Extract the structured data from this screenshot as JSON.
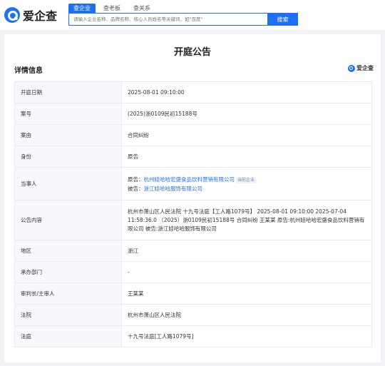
{
  "header": {
    "logo_text": "爱企查",
    "tabs": [
      {
        "label": "查企业",
        "active": true
      },
      {
        "label": "查老板",
        "active": false
      },
      {
        "label": "查关系",
        "active": false
      }
    ],
    "search_placeholder": "请输入企业名称、品牌名称、核心人员姓名等关键词，如\"百度\"",
    "search_button": "搜索"
  },
  "page": {
    "title": "开庭公告",
    "section_title": "详情信息",
    "brand_label": "爱企查"
  },
  "details": {
    "hearing_date": {
      "label": "开庭日期",
      "value": "2025-08-01 09:10:00"
    },
    "case_no": {
      "label": "案号",
      "value": "(2025)浙0109民初15188号"
    },
    "cause": {
      "label": "案由",
      "value": "合同纠纷"
    },
    "role": {
      "label": "身份",
      "value": "原告"
    },
    "parties": {
      "label": "当事人",
      "plaintiff_prefix": "原告：",
      "plaintiff": "杭州娃哈哈宏盛食品饮料营销有限公司",
      "plaintiff_tag": "当前企业",
      "defendant_prefix": "被告：",
      "defendant": "浙江娃哈哈服饰有限公司"
    },
    "content": {
      "label": "公告内容",
      "value": "杭州市萧山区人民法院 十九号法庭【工人路1079号】 2025-08-01 09:10:00 2025-07-04 11:58:36.0 （2025）浙0109民初15188号 合同纠纷 王某某 原告:杭州娃哈哈宏盛食品饮料营销有限公司 被告:浙江娃哈哈服饰有限公司"
    },
    "region": {
      "label": "地区",
      "value": "浙江"
    },
    "department": {
      "label": "承办部门",
      "value": "-"
    },
    "judge": {
      "label": "审判长/主审人",
      "value": "王某某"
    },
    "court": {
      "label": "法院",
      "value": "杭州市萧山区人民法院"
    },
    "courtroom": {
      "label": "法庭",
      "value": "十九号法庭[工人路1079号]"
    }
  }
}
